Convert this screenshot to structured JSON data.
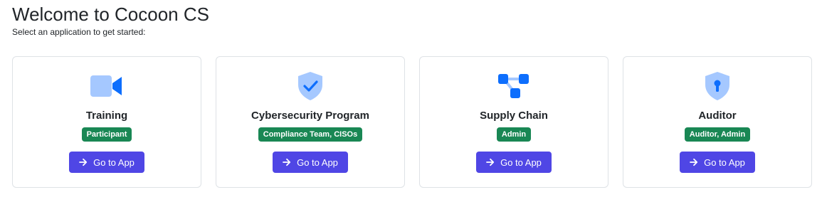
{
  "header": {
    "title": "Welcome to Cocoon CS",
    "subtitle": "Select an application to get started:"
  },
  "apps": [
    {
      "name": "Training",
      "roles": "Participant",
      "icon": "video-camera-icon",
      "button_label": "Go to App"
    },
    {
      "name": "Cybersecurity Program",
      "roles": "Compliance Team, CISOs",
      "icon": "shield-check-icon",
      "button_label": "Go to App"
    },
    {
      "name": "Supply Chain",
      "roles": "Admin",
      "icon": "network-nodes-icon",
      "button_label": "Go to App"
    },
    {
      "name": "Auditor",
      "roles": "Auditor, Admin",
      "icon": "shield-keyhole-icon",
      "button_label": "Go to App"
    }
  ],
  "colors": {
    "icon_light": "#a5c8ff",
    "icon_dark": "#0d6efd",
    "badge": "#198754",
    "button": "#4f46e5"
  }
}
